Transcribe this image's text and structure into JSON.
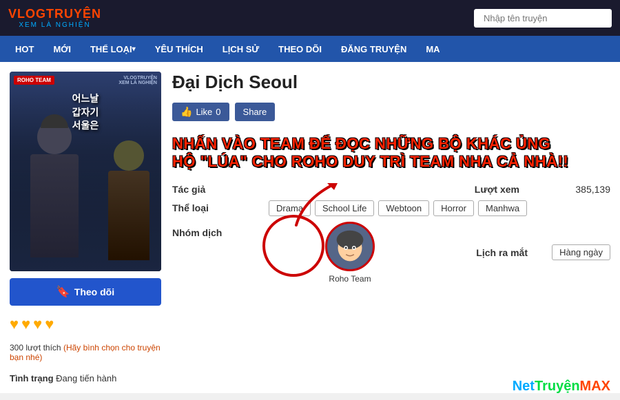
{
  "site": {
    "logo_main": "VLOGTRUYỆN",
    "logo_sub": "XEM LÀ NGHIỆN",
    "search_placeholder": "Nhập tên truyện"
  },
  "nav": {
    "items": [
      {
        "label": "HOT",
        "id": "hot"
      },
      {
        "label": "MỚI",
        "id": "moi"
      },
      {
        "label": "THỂ LOẠI",
        "id": "the-loai",
        "dropdown": true
      },
      {
        "label": "YÊU THÍCH",
        "id": "yeu-thich"
      },
      {
        "label": "LỊCH SỬ",
        "id": "lich-su"
      },
      {
        "label": "THEO DÕI",
        "id": "theo-doi"
      },
      {
        "label": "ĐĂNG TRUYỆN",
        "id": "dang-truyen"
      },
      {
        "label": "MA",
        "id": "ma"
      }
    ]
  },
  "manga": {
    "title": "Đại Dịch Seoul",
    "cover_team": "ROHO TEAM",
    "cover_watermark": "VLOGTRUYỆN\nXEM LÀ NGHIỆN",
    "cover_title_kr": "어느날 갑자기 서울은",
    "like_count": "0",
    "like_label": "Like",
    "share_label": "Share",
    "overlay_text_line1": "NHẤN VÀO TEAM ĐỂ ĐỌC NHỮNG BỘ KHÁC ỦNG",
    "overlay_text_line2": "HỘ \"LÚA\" CHO ROHO DUY TRÌ TEAM NHA CẢ NHÀ!!",
    "tac_gia_label": "Tác giả",
    "tac_gia_value": "",
    "luot_xem_label": "Lượt xem",
    "luot_xem_value": "385,139",
    "the_loai_label": "Thể loại",
    "tags": [
      "Drama",
      "School Life",
      "Webtoon",
      "Horror",
      "Manhwa"
    ],
    "nhom_dich_label": "Nhóm dịch",
    "team_name": "Roho Team",
    "lich_ra_mat_label": "Lịch ra mắt",
    "release_schedule": "Hàng ngày",
    "follow_btn": "Theo dõi",
    "stars": 4,
    "rating_count": "300 lượt thích",
    "rating_cta": "(Hãy bình chọn cho truyện bạn nhé)",
    "tinh_trang_label": "Tình trạng",
    "tinh_trang_value": "Đang tiến hành"
  },
  "watermark": {
    "net": "Net",
    "truyen": "Truyện",
    "max": "MAX"
  },
  "colors": {
    "accent_blue": "#2255aa",
    "accent_red": "#cc0000",
    "logo_red": "#ff4400",
    "nav_bg": "#2255aa",
    "star_color": "#ffaa00"
  }
}
